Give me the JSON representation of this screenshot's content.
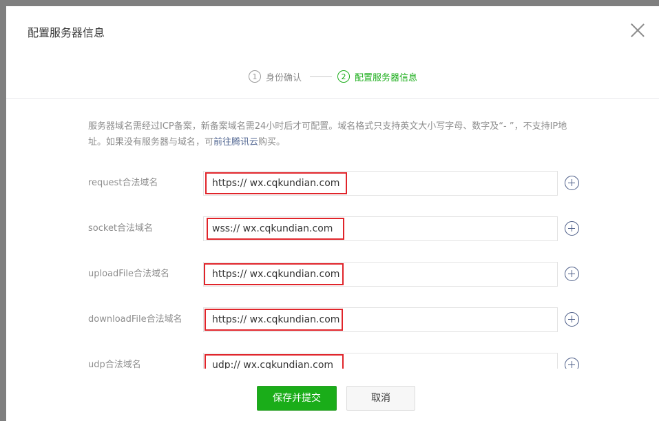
{
  "dialog": {
    "title": "配置服务器信息",
    "close_icon": "close-icon"
  },
  "steps": [
    {
      "num": "1",
      "label": "身份确认",
      "active": false
    },
    {
      "num": "2",
      "label": "配置服务器信息",
      "active": true
    }
  ],
  "notice": {
    "text_before_link": "服务器域名需经过ICP备案，新备案域名需24小时后才可配置。域名格式只支持英文大小写字母、数字及“- ”，不支持IP地址。如果没有服务器与域名，可",
    "link_text": "前往腾讯云",
    "text_after_link": "购买。"
  },
  "domains": [
    {
      "label": "request合法域名",
      "value": "https:// wx.cqkundian.com"
    },
    {
      "label": "socket合法域名",
      "value": "wss:// wx.cqkundian.com"
    },
    {
      "label": "uploadFile合法域名",
      "value": "https:// wx.cqkundian.com"
    },
    {
      "label": "downloadFile合法域名",
      "value": "https:// wx.cqkundian.com"
    },
    {
      "label": "udp合法域名",
      "value": "udp:// wx.cqkundian.com"
    }
  ],
  "buttons": {
    "submit": "保存并提交",
    "cancel": "取消"
  },
  "colors": {
    "primary": "#1aad19",
    "highlight": "#e0242a",
    "link": "#576b95"
  }
}
